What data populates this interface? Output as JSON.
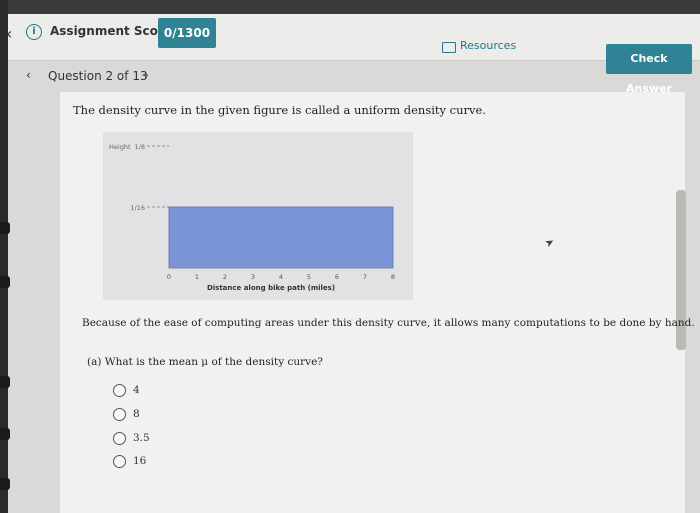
{
  "header": {
    "score_label": "Assignment Score:",
    "score_value": "0/1300",
    "resources_label": "Resources",
    "check_answer_label": "Check Answer"
  },
  "question_nav": {
    "label": "Question 2 of 13",
    "prev_icon": "chevron-left-icon",
    "next_icon": "chevron-right-icon"
  },
  "question": {
    "intro": "The density curve in the given figure is called a uniform density curve.",
    "because": "Because of the ease of computing areas under this density curve, it allows many computations to be done by hand.",
    "part_a": "(a) What is the mean μ of the density curve?",
    "choices": [
      {
        "label": "4"
      },
      {
        "label": "8"
      },
      {
        "label": "3.5"
      },
      {
        "label": "16"
      }
    ]
  },
  "chart_data": {
    "type": "area",
    "x": [
      0,
      8
    ],
    "values": [
      0.0625,
      0.0625
    ],
    "ylabel": "Height",
    "xlabel": "Distance along bike path (miles)",
    "x_ticks": [
      0,
      1,
      2,
      3,
      4,
      5,
      6,
      7,
      8
    ],
    "y_ticks": [
      {
        "value": 0.125,
        "label": "1/8"
      },
      {
        "value": 0.0625,
        "label": "1/16"
      }
    ],
    "xlim": [
      0,
      8
    ],
    "ylim": [
      0,
      0.125
    ],
    "fill_color": "#7b95d6",
    "grid": false
  }
}
